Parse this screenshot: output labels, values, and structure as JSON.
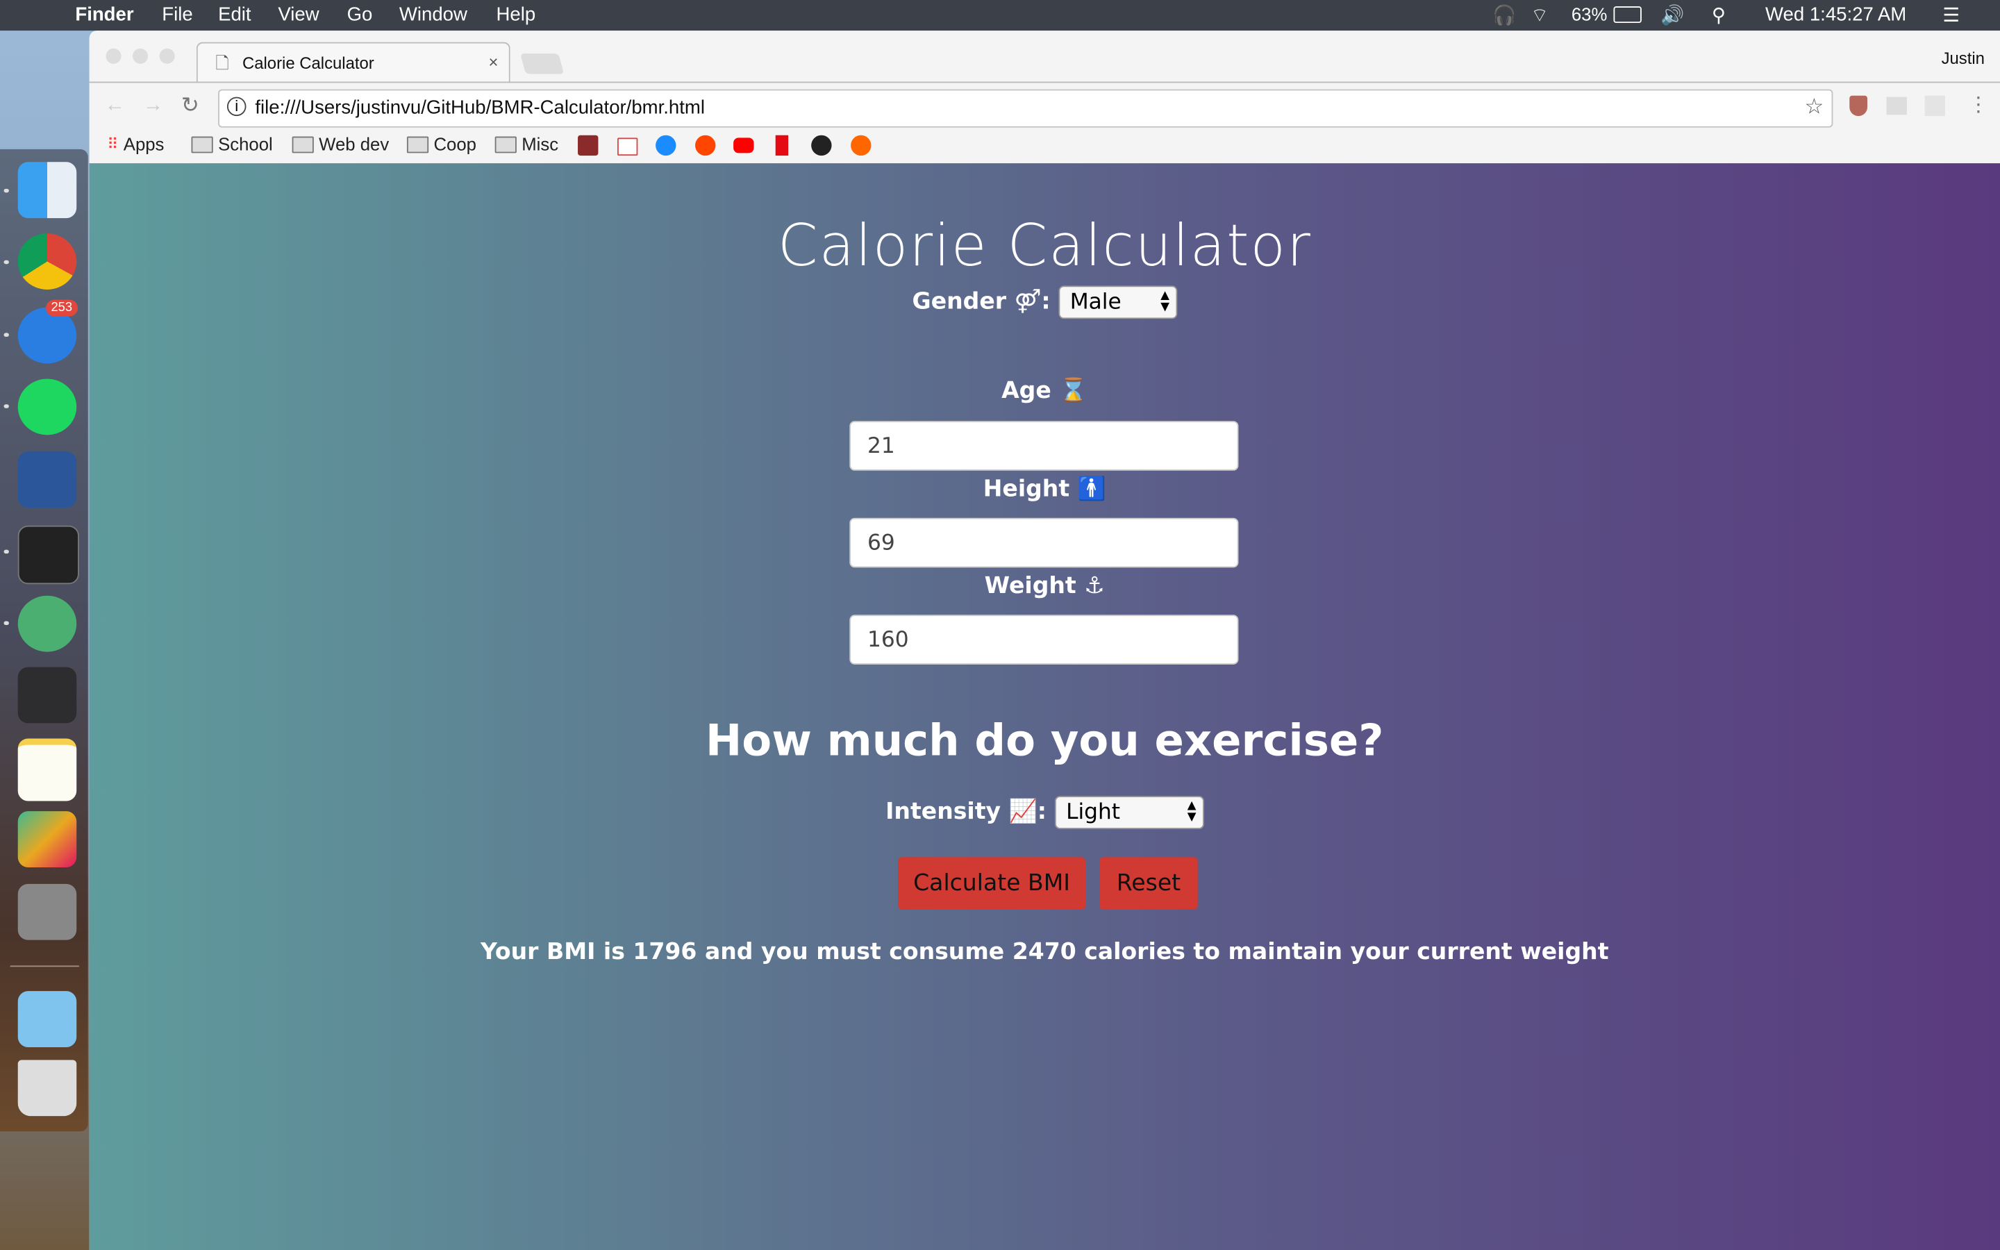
{
  "menubar": {
    "app": "Finder",
    "items": [
      "File",
      "Edit",
      "View",
      "Go",
      "Window",
      "Help"
    ],
    "battery": "63%",
    "clock": "Wed 1:45:27 AM"
  },
  "dock": {
    "mail_badge": "253"
  },
  "browser": {
    "tab_title": "Calorie Calculator",
    "profile": "Justin",
    "url": "file:///Users/justinvu/GitHub/BMR-Calculator/bmr.html",
    "bookmarks": [
      "Apps",
      "School",
      "Web dev",
      "Coop",
      "Misc"
    ]
  },
  "page": {
    "title": "Calorie Calculator",
    "gender_label": "Gender ⚤:",
    "gender_value": "Male",
    "age_label": "Age ⌛",
    "age_value": "21",
    "height_label": "Height 🚹",
    "height_value": "69",
    "weight_label": "Weight ⚓",
    "weight_value": "160",
    "exercise_heading": "How much do you exercise?",
    "intensity_label": "Intensity 📈:",
    "intensity_value": "Light",
    "calculate_label": "Calculate BMI",
    "reset_label": "Reset",
    "result": "Your BMI is 1796 and you must consume 2470 calories to maintain your current weight"
  },
  "colors": {
    "button": "#d03a32",
    "gradient_start": "#5f9c9d",
    "gradient_end": "#5a3a7e",
    "menubar": "#3b4049"
  }
}
